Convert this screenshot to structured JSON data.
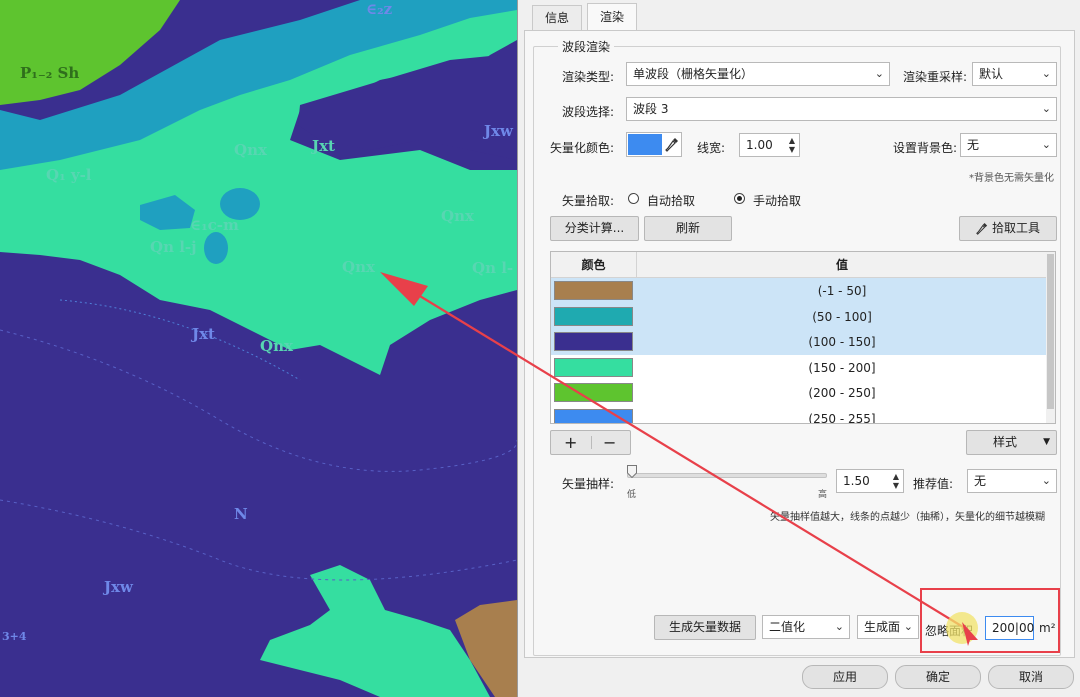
{
  "map": {
    "labels": [
      "P₁₋₂ Sh",
      "∈₂z",
      "Q₁ y-l",
      "Qnx",
      "Jxt",
      "Jxw",
      "∈₁c-m",
      "Qn l-j",
      "Qnx",
      "Qn l-",
      "Qnx",
      "Jxt",
      "Qnx",
      "N",
      "Jxw",
      "3+4"
    ]
  },
  "panel": {
    "tabs": [
      "信息",
      "渲染"
    ],
    "group_title": "波段渲染",
    "render_type_label": "渲染类型:",
    "render_type_value": "单波段（栅格矢量化）",
    "resample_label": "渲染重采样:",
    "resample_value": "默认",
    "band_label": "波段选择:",
    "band_value": "波段 3",
    "vector_color_label": "矢量化颜色:",
    "vector_color": "#3d8bf0",
    "line_width_label": "线宽:",
    "line_width_value": "1.00",
    "bg_color_label": "设置背景色:",
    "bg_color_value": "无",
    "bg_note": "*背景色无需矢量化",
    "pick_label": "矢量拾取:",
    "pick_auto": "自动拾取",
    "pick_manual": "手动拾取",
    "pick_selected": "手动拾取",
    "classify_btn": "分类计算...",
    "refresh_btn": "刷新",
    "pick_tool_btn": "拾取工具",
    "table": {
      "col_color": "颜色",
      "col_value": "值",
      "rows": [
        {
          "color": "#a87f4e",
          "value": "(-1 - 50]",
          "selected": true
        },
        {
          "color": "#1faab0",
          "value": "(50 - 100]",
          "selected": true
        },
        {
          "color": "#3a2f8f",
          "value": "(100 - 150]",
          "selected": true
        },
        {
          "color": "#35dea0",
          "value": "(150 - 200]",
          "selected": false
        },
        {
          "color": "#5ec42f",
          "value": "(200 - 250]",
          "selected": false
        },
        {
          "color": "#3d8bf0",
          "value": "(250 - 255]",
          "selected": false
        }
      ]
    },
    "add_btn": "+",
    "remove_btn": "−",
    "style_btn": "样式",
    "sample_label": "矢量抽样:",
    "slider_low": "低",
    "slider_high": "高",
    "slider_position": 0.0,
    "sample_value": "1.50",
    "recommend_label": "推荐值:",
    "recommend_value": "无",
    "sample_note": "矢量抽样值越大，线条的点越少（抽稀），矢量化的细节越模糊",
    "generate_btn": "生成矢量数据",
    "binarize_value": "二值化",
    "geom_value": "生成面",
    "ignore_area_label": "忽略面积",
    "ignore_area_value": "200|00",
    "area_unit": "m²",
    "apply_btn": "应用",
    "ok_btn": "确定",
    "cancel_btn": "取消"
  },
  "colors": {
    "map_purple": "#3a2f8f",
    "map_teal": "#35dea0",
    "map_blue": "#1fa0c0",
    "map_green": "#5ec42f",
    "map_brown": "#a87f4e",
    "annotation_red": "#e8404a"
  }
}
